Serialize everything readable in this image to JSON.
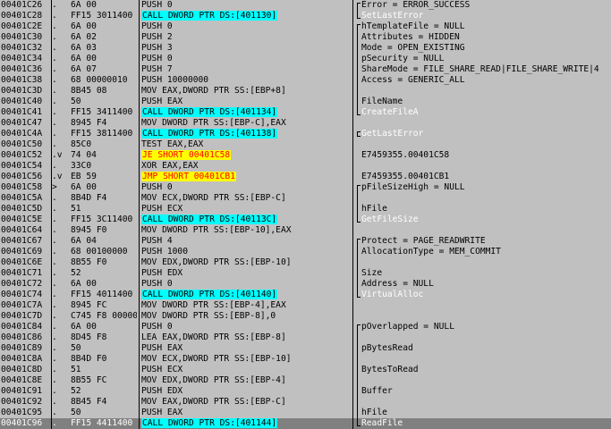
{
  "colors": {
    "background": "#c0c0c0",
    "call_highlight": "#00ffff",
    "jump_highlight": "#ffff00",
    "jump_text": "#ff0000",
    "selection": "#808080",
    "api_comment": "#ffffff"
  },
  "rows": [
    {
      "addr": "00401C26",
      "mark": ".",
      "hex": "6A 00",
      "asm": "PUSH 0",
      "comment": "Error = ERROR_SUCCESS",
      "asm_hl": "",
      "cmt_api": false
    },
    {
      "addr": "00401C28",
      "mark": ".",
      "hex": "FF15 3011400",
      "asm": "CALL DWORD PTR DS:[401130]",
      "comment": "SetLastError",
      "asm_hl": "cyan",
      "cmt_api": true
    },
    {
      "addr": "00401C2E",
      "mark": ".",
      "hex": "6A 00",
      "asm": "PUSH 0",
      "comment": "hTemplateFile = NULL",
      "asm_hl": "",
      "cmt_api": false
    },
    {
      "addr": "00401C30",
      "mark": ".",
      "hex": "6A 02",
      "asm": "PUSH 2",
      "comment": "Attributes = HIDDEN",
      "asm_hl": "",
      "cmt_api": false
    },
    {
      "addr": "00401C32",
      "mark": ".",
      "hex": "6A 03",
      "asm": "PUSH 3",
      "comment": "Mode = OPEN_EXISTING",
      "asm_hl": "",
      "cmt_api": false
    },
    {
      "addr": "00401C34",
      "mark": ".",
      "hex": "6A 00",
      "asm": "PUSH 0",
      "comment": "pSecurity = NULL",
      "asm_hl": "",
      "cmt_api": false
    },
    {
      "addr": "00401C36",
      "mark": ".",
      "hex": "6A 07",
      "asm": "PUSH 7",
      "comment": "ShareMode = FILE_SHARE_READ|FILE_SHARE_WRITE|4",
      "asm_hl": "",
      "cmt_api": false
    },
    {
      "addr": "00401C38",
      "mark": ".",
      "hex": "68 00000010",
      "asm": "PUSH 10000000",
      "comment": "Access = GENERIC_ALL",
      "asm_hl": "",
      "cmt_api": false
    },
    {
      "addr": "00401C3D",
      "mark": ".",
      "hex": "8B45 08",
      "asm": "MOV EAX,DWORD PTR SS:[EBP+8]",
      "comment": "",
      "asm_hl": "",
      "cmt_api": false
    },
    {
      "addr": "00401C40",
      "mark": ".",
      "hex": "50",
      "asm": "PUSH EAX",
      "comment": "FileName",
      "asm_hl": "",
      "cmt_api": false
    },
    {
      "addr": "00401C41",
      "mark": ".",
      "hex": "FF15 3411400",
      "asm": "CALL DWORD PTR DS:[401134]",
      "comment": "CreateFileA",
      "asm_hl": "cyan",
      "cmt_api": true
    },
    {
      "addr": "00401C47",
      "mark": ".",
      "hex": "8945 F4",
      "asm": "MOV DWORD PTR SS:[EBP-C],EAX",
      "comment": "",
      "asm_hl": "",
      "cmt_api": false
    },
    {
      "addr": "00401C4A",
      "mark": ".",
      "hex": "FF15 3811400",
      "asm": "CALL DWORD PTR DS:[401138]",
      "comment": "GetLastError",
      "asm_hl": "cyan",
      "cmt_api": true
    },
    {
      "addr": "00401C50",
      "mark": ".",
      "hex": "85C0",
      "asm": "TEST EAX,EAX",
      "comment": "",
      "asm_hl": "",
      "cmt_api": false
    },
    {
      "addr": "00401C52",
      "mark": ".v",
      "hex": "74 04",
      "asm": "JE SHORT 00401C58",
      "comment": "E7459355.00401C58",
      "asm_hl": "yellow",
      "cmt_api": false
    },
    {
      "addr": "00401C54",
      "mark": ".",
      "hex": "33C0",
      "asm": "XOR EAX,EAX",
      "comment": "",
      "asm_hl": "",
      "cmt_api": false
    },
    {
      "addr": "00401C56",
      "mark": ".v",
      "hex": "EB 59",
      "asm": "JMP SHORT 00401CB1",
      "comment": "E7459355.00401CB1",
      "asm_hl": "yellow",
      "cmt_api": false
    },
    {
      "addr": "00401C58",
      "mark": ">",
      "hex": "6A 00",
      "asm": "PUSH 0",
      "comment": "pFileSizeHigh = NULL",
      "asm_hl": "",
      "cmt_api": false
    },
    {
      "addr": "00401C5A",
      "mark": ".",
      "hex": "8B4D F4",
      "asm": "MOV ECX,DWORD PTR SS:[EBP-C]",
      "comment": "",
      "asm_hl": "",
      "cmt_api": false
    },
    {
      "addr": "00401C5D",
      "mark": ".",
      "hex": "51",
      "asm": "PUSH ECX",
      "comment": "hFile",
      "asm_hl": "",
      "cmt_api": false
    },
    {
      "addr": "00401C5E",
      "mark": ".",
      "hex": "FF15 3C11400",
      "asm": "CALL DWORD PTR DS:[40113C]",
      "comment": "GetFileSize",
      "asm_hl": "cyan",
      "cmt_api": true
    },
    {
      "addr": "00401C64",
      "mark": ".",
      "hex": "8945 F0",
      "asm": "MOV DWORD PTR SS:[EBP-10],EAX",
      "comment": "",
      "asm_hl": "",
      "cmt_api": false
    },
    {
      "addr": "00401C67",
      "mark": ".",
      "hex": "6A 04",
      "asm": "PUSH 4",
      "comment": "Protect = PAGE_READWRITE",
      "asm_hl": "",
      "cmt_api": false
    },
    {
      "addr": "00401C69",
      "mark": ".",
      "hex": "68 00100000",
      "asm": "PUSH 1000",
      "comment": "AllocationType = MEM_COMMIT",
      "asm_hl": "",
      "cmt_api": false
    },
    {
      "addr": "00401C6E",
      "mark": ".",
      "hex": "8B55 F0",
      "asm": "MOV EDX,DWORD PTR SS:[EBP-10]",
      "comment": "",
      "asm_hl": "",
      "cmt_api": false
    },
    {
      "addr": "00401C71",
      "mark": ".",
      "hex": "52",
      "asm": "PUSH EDX",
      "comment": "Size",
      "asm_hl": "",
      "cmt_api": false
    },
    {
      "addr": "00401C72",
      "mark": ".",
      "hex": "6A 00",
      "asm": "PUSH 0",
      "comment": "Address = NULL",
      "asm_hl": "",
      "cmt_api": false
    },
    {
      "addr": "00401C74",
      "mark": ".",
      "hex": "FF15 4011400",
      "asm": "CALL DWORD PTR DS:[401140]",
      "comment": "VirtualAlloc",
      "asm_hl": "cyan",
      "cmt_api": true
    },
    {
      "addr": "00401C7A",
      "mark": ".",
      "hex": "8945 FC",
      "asm": "MOV DWORD PTR SS:[EBP-4],EAX",
      "comment": "",
      "asm_hl": "",
      "cmt_api": false
    },
    {
      "addr": "00401C7D",
      "mark": ".",
      "hex": "C745 F8 00000",
      "asm": "MOV DWORD PTR SS:[EBP-8],0",
      "comment": "",
      "asm_hl": "",
      "cmt_api": false
    },
    {
      "addr": "00401C84",
      "mark": ".",
      "hex": "6A 00",
      "asm": "PUSH 0",
      "comment": "pOverlapped = NULL",
      "asm_hl": "",
      "cmt_api": false
    },
    {
      "addr": "00401C86",
      "mark": ".",
      "hex": "8D45 F8",
      "asm": "LEA EAX,DWORD PTR SS:[EBP-8]",
      "comment": "",
      "asm_hl": "",
      "cmt_api": false
    },
    {
      "addr": "00401C89",
      "mark": ".",
      "hex": "50",
      "asm": "PUSH EAX",
      "comment": "pBytesRead",
      "asm_hl": "",
      "cmt_api": false
    },
    {
      "addr": "00401C8A",
      "mark": ".",
      "hex": "8B4D F0",
      "asm": "MOV ECX,DWORD PTR SS:[EBP-10]",
      "comment": "",
      "asm_hl": "",
      "cmt_api": false
    },
    {
      "addr": "00401C8D",
      "mark": ".",
      "hex": "51",
      "asm": "PUSH ECX",
      "comment": "BytesToRead",
      "asm_hl": "",
      "cmt_api": false
    },
    {
      "addr": "00401C8E",
      "mark": ".",
      "hex": "8B55 FC",
      "asm": "MOV EDX,DWORD PTR SS:[EBP-4]",
      "comment": "",
      "asm_hl": "",
      "cmt_api": false
    },
    {
      "addr": "00401C91",
      "mark": ".",
      "hex": "52",
      "asm": "PUSH EDX",
      "comment": "Buffer",
      "asm_hl": "",
      "cmt_api": false
    },
    {
      "addr": "00401C92",
      "mark": ".",
      "hex": "8B45 F4",
      "asm": "MOV EAX,DWORD PTR SS:[EBP-C]",
      "comment": "",
      "asm_hl": "",
      "cmt_api": false
    },
    {
      "addr": "00401C95",
      "mark": ".",
      "hex": "50",
      "asm": "PUSH EAX",
      "comment": "hFile",
      "asm_hl": "",
      "cmt_api": false
    },
    {
      "addr": "00401C96",
      "mark": ".",
      "hex": "FF15 4411400",
      "asm": "CALL DWORD PTR DS:[401144]",
      "comment": "ReadFile",
      "asm_hl": "cyan",
      "cmt_api": true,
      "selected": true
    }
  ]
}
